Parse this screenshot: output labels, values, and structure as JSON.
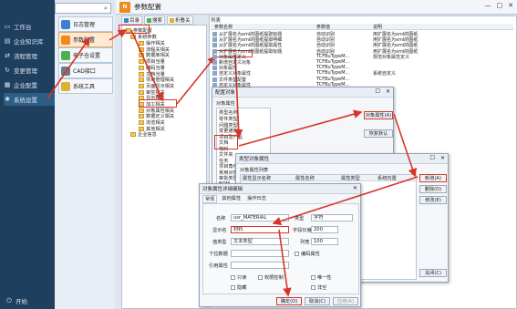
{
  "nav": {
    "search_placeholder": "",
    "items": [
      {
        "label": "工作台",
        "icon": "monitor-icon"
      },
      {
        "label": "企业知识库",
        "icon": "book-icon"
      },
      {
        "label": "流程管理",
        "icon": "flow-icon"
      },
      {
        "label": "变更管理",
        "icon": "change-icon"
      },
      {
        "label": "企业配置",
        "icon": "building-icon"
      },
      {
        "label": "系统设置",
        "icon": "gear-icon"
      }
    ],
    "start_label": "开始"
  },
  "modules": [
    {
      "label": "日志管理",
      "color": "#3f7fd0"
    },
    {
      "label": "参数配置",
      "color": "#f28a1a"
    },
    {
      "label": "电子仓设置",
      "color": "#4caf50"
    },
    {
      "label": "CAD接口",
      "color": "#6c7a89"
    },
    {
      "label": "系统工具",
      "color": "#e0b030"
    }
  ],
  "header": {
    "logo": "N",
    "title": "参数配置"
  },
  "toolbar": [
    "目录",
    "搜索",
    "折叠关"
  ],
  "tree": {
    "root": "参数配置",
    "group": "系统参数",
    "items": [
      "操作相关",
      "流程关相关",
      "数据库相关",
      "项目当量",
      "编码当量",
      "文档当量",
      "项目管理相关",
      "页面显示相关",
      "审签相关",
      "显示相关",
      "加工相关",
      "对象属性相关",
      "数据定义相关",
      "浏览相关",
      "其他相关"
    ],
    "other_group": "企业信息"
  },
  "list": {
    "header": "列表",
    "columns": [
      "参数名称",
      "参数值",
      "说明"
    ],
    "rows": [
      {
        "name": "从扩展名为xml的图纸提取标题",
        "value": "自动识别",
        "desc": "用扩展名为xml的图纸"
      },
      {
        "name": "从扩展名为xml的图纸提取明细",
        "value": "自动识别",
        "desc": "用扩展名为xml的图纸"
      },
      {
        "name": "从扩展名为xml的图纸提取属性",
        "value": "自动识别",
        "desc": "用扩展名为xml的图纸"
      },
      {
        "name": "从扩展名为xml的图纸提取标题",
        "value": "自动识别",
        "desc": "用扩展名为xml的图纸"
      },
      {
        "name": "对象属性定义",
        "value": "TCFBuTypeM...",
        "desc": "规范对象属性定义"
      },
      {
        "name": "新增自定义对象",
        "value": "TCFBuTypeM...",
        "desc": ""
      },
      {
        "name": "对象属性",
        "value": "TCFBuTypeM...",
        "desc": ""
      },
      {
        "name": "自定义对象属性",
        "value": "TCFBuTypeM...",
        "desc": "系统自定义"
      },
      {
        "name": "文件类型配置",
        "value": "TCFBuTypeM...",
        "desc": ""
      },
      {
        "name": "自定义对象属性",
        "value": "TCFBuTypeM...",
        "desc": ""
      }
    ]
  },
  "dlg_object": {
    "title": "配置对象",
    "section": "对象属性",
    "col": "类型名称",
    "items": [
      "零件类型",
      "问题类型",
      "变更通知",
      "项目及产品",
      "文档",
      "物料",
      "文件夹",
      "任务",
      "项目角色用户",
      "常用对象",
      "审批类型",
      "BOM"
    ],
    "btn_attr": "对象属性(A)",
    "btn_default": "恢复默认"
  },
  "dlg_attrs": {
    "title": "类型对象属性",
    "section": "对象属性列表",
    "columns": [
      "属性显示名称",
      "属性名称",
      "属性类型",
      "系统内置"
    ],
    "btn_add": "新增(A)",
    "btn_del": "删除(D)",
    "btn_edit": "修改(E)",
    "btn_close": "关闭(C)"
  },
  "dlg_edit": {
    "title": "对象属性详细编辑",
    "tabs": [
      "常规",
      "其他属性",
      "操作日志"
    ],
    "name_label": "名称",
    "name_value": "usr_MATERIAL",
    "display_label": "显示名",
    "display_value": "材料",
    "value_type_label": "值类型",
    "value_type_value": "文本类型",
    "dropdown_label": "下拉数据",
    "ref_label": "引用属性",
    "type_label": "类型",
    "type_value": "字符",
    "length_label": "字段长度",
    "length_value": "200",
    "width_label": "列宽",
    "width_value": "100",
    "link_label": "编码属性",
    "chk_readonly": "只读",
    "chk_permission": "权限控制",
    "chk_unique": "唯一性",
    "chk_hidden": "隐藏",
    "chk_required": "非空",
    "ok": "确定(O)",
    "cancel": "取消(C)",
    "apply": "应用(A)"
  },
  "colors": {
    "nav_bg": "#1f3f5f",
    "accent": "#f28a1a",
    "highlight": "#d6362a"
  }
}
